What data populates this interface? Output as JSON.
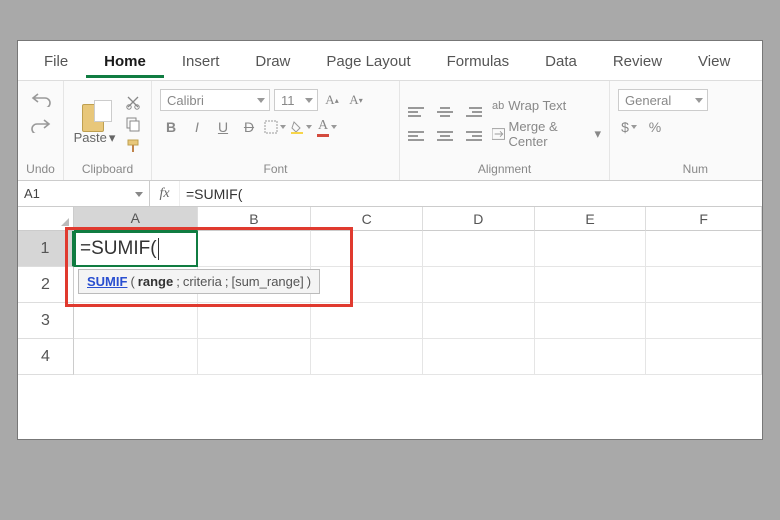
{
  "tabs": {
    "file": "File",
    "home": "Home",
    "insert": "Insert",
    "draw": "Draw",
    "page_layout": "Page Layout",
    "formulas": "Formulas",
    "data": "Data",
    "review": "Review",
    "view": "View",
    "active": "home"
  },
  "ribbon": {
    "undo_label": "Undo",
    "clipboard_label": "Clipboard",
    "paste_label": "Paste",
    "font_label": "Font",
    "font_name": "Calibri",
    "font_size": "11",
    "alignment_label": "Alignment",
    "wrap_text": "Wrap Text",
    "merge_center": "Merge & Center",
    "number_label": "Num",
    "number_format": "General"
  },
  "formula_bar": {
    "name_box": "A1",
    "fx": "fx",
    "formula": "=SUMIF("
  },
  "grid": {
    "columns": [
      "A",
      "B",
      "C",
      "D",
      "E",
      "F"
    ],
    "rows": [
      "1",
      "2",
      "3",
      "4"
    ],
    "active_cell_value": "=SUMIF("
  },
  "tooltip": {
    "fn_name": "SUMIF",
    "open": "(",
    "arg1": "range",
    "sep": "; ",
    "arg2": "criteria",
    "arg3": "[sum_range]",
    "close": ")"
  }
}
